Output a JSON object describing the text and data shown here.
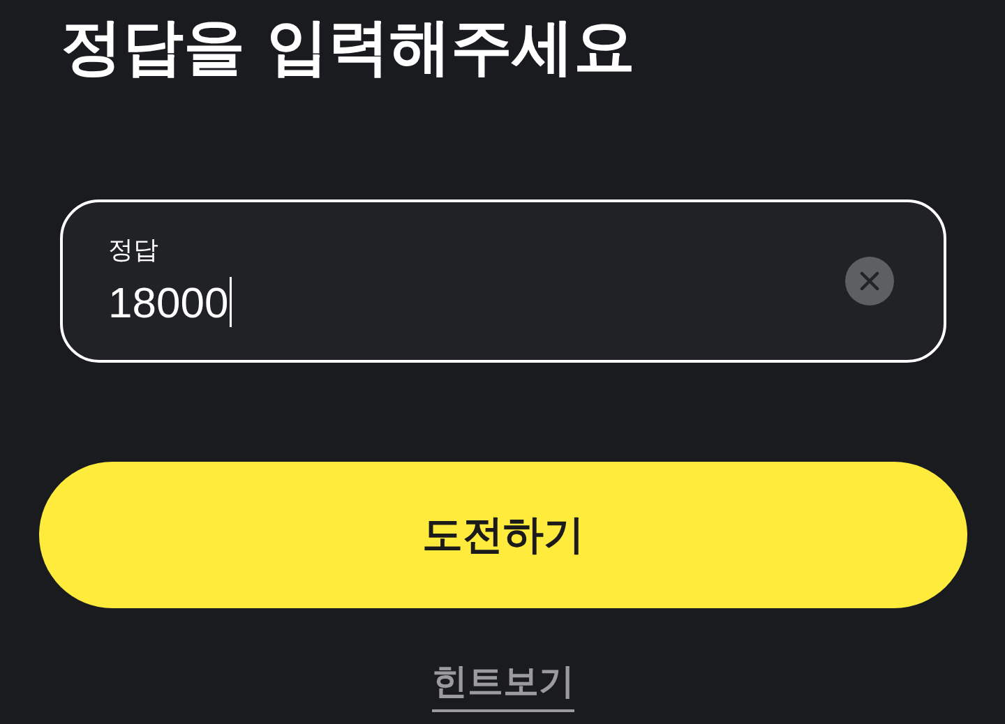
{
  "title": "정답을 입력해주세요",
  "answer_field": {
    "label": "정답",
    "value": "18000",
    "focused": true
  },
  "submit_button": {
    "label": "도전하기"
  },
  "hint_link": {
    "label": "힌트보기"
  }
}
